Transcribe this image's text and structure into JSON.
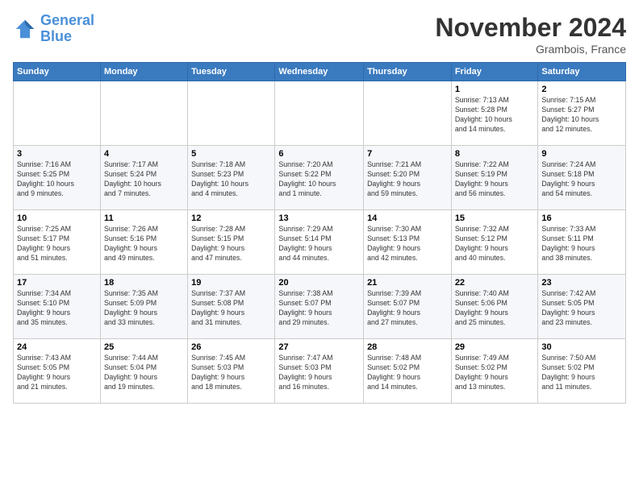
{
  "logo": {
    "line1": "General",
    "line2": "Blue"
  },
  "title": "November 2024",
  "location": "Grambois, France",
  "days_header": [
    "Sunday",
    "Monday",
    "Tuesday",
    "Wednesday",
    "Thursday",
    "Friday",
    "Saturday"
  ],
  "weeks": [
    [
      {
        "day": "",
        "info": ""
      },
      {
        "day": "",
        "info": ""
      },
      {
        "day": "",
        "info": ""
      },
      {
        "day": "",
        "info": ""
      },
      {
        "day": "",
        "info": ""
      },
      {
        "day": "1",
        "info": "Sunrise: 7:13 AM\nSunset: 5:28 PM\nDaylight: 10 hours\nand 14 minutes."
      },
      {
        "day": "2",
        "info": "Sunrise: 7:15 AM\nSunset: 5:27 PM\nDaylight: 10 hours\nand 12 minutes."
      }
    ],
    [
      {
        "day": "3",
        "info": "Sunrise: 7:16 AM\nSunset: 5:25 PM\nDaylight: 10 hours\nand 9 minutes."
      },
      {
        "day": "4",
        "info": "Sunrise: 7:17 AM\nSunset: 5:24 PM\nDaylight: 10 hours\nand 7 minutes."
      },
      {
        "day": "5",
        "info": "Sunrise: 7:18 AM\nSunset: 5:23 PM\nDaylight: 10 hours\nand 4 minutes."
      },
      {
        "day": "6",
        "info": "Sunrise: 7:20 AM\nSunset: 5:22 PM\nDaylight: 10 hours\nand 1 minute."
      },
      {
        "day": "7",
        "info": "Sunrise: 7:21 AM\nSunset: 5:20 PM\nDaylight: 9 hours\nand 59 minutes."
      },
      {
        "day": "8",
        "info": "Sunrise: 7:22 AM\nSunset: 5:19 PM\nDaylight: 9 hours\nand 56 minutes."
      },
      {
        "day": "9",
        "info": "Sunrise: 7:24 AM\nSunset: 5:18 PM\nDaylight: 9 hours\nand 54 minutes."
      }
    ],
    [
      {
        "day": "10",
        "info": "Sunrise: 7:25 AM\nSunset: 5:17 PM\nDaylight: 9 hours\nand 51 minutes."
      },
      {
        "day": "11",
        "info": "Sunrise: 7:26 AM\nSunset: 5:16 PM\nDaylight: 9 hours\nand 49 minutes."
      },
      {
        "day": "12",
        "info": "Sunrise: 7:28 AM\nSunset: 5:15 PM\nDaylight: 9 hours\nand 47 minutes."
      },
      {
        "day": "13",
        "info": "Sunrise: 7:29 AM\nSunset: 5:14 PM\nDaylight: 9 hours\nand 44 minutes."
      },
      {
        "day": "14",
        "info": "Sunrise: 7:30 AM\nSunset: 5:13 PM\nDaylight: 9 hours\nand 42 minutes."
      },
      {
        "day": "15",
        "info": "Sunrise: 7:32 AM\nSunset: 5:12 PM\nDaylight: 9 hours\nand 40 minutes."
      },
      {
        "day": "16",
        "info": "Sunrise: 7:33 AM\nSunset: 5:11 PM\nDaylight: 9 hours\nand 38 minutes."
      }
    ],
    [
      {
        "day": "17",
        "info": "Sunrise: 7:34 AM\nSunset: 5:10 PM\nDaylight: 9 hours\nand 35 minutes."
      },
      {
        "day": "18",
        "info": "Sunrise: 7:35 AM\nSunset: 5:09 PM\nDaylight: 9 hours\nand 33 minutes."
      },
      {
        "day": "19",
        "info": "Sunrise: 7:37 AM\nSunset: 5:08 PM\nDaylight: 9 hours\nand 31 minutes."
      },
      {
        "day": "20",
        "info": "Sunrise: 7:38 AM\nSunset: 5:07 PM\nDaylight: 9 hours\nand 29 minutes."
      },
      {
        "day": "21",
        "info": "Sunrise: 7:39 AM\nSunset: 5:07 PM\nDaylight: 9 hours\nand 27 minutes."
      },
      {
        "day": "22",
        "info": "Sunrise: 7:40 AM\nSunset: 5:06 PM\nDaylight: 9 hours\nand 25 minutes."
      },
      {
        "day": "23",
        "info": "Sunrise: 7:42 AM\nSunset: 5:05 PM\nDaylight: 9 hours\nand 23 minutes."
      }
    ],
    [
      {
        "day": "24",
        "info": "Sunrise: 7:43 AM\nSunset: 5:05 PM\nDaylight: 9 hours\nand 21 minutes."
      },
      {
        "day": "25",
        "info": "Sunrise: 7:44 AM\nSunset: 5:04 PM\nDaylight: 9 hours\nand 19 minutes."
      },
      {
        "day": "26",
        "info": "Sunrise: 7:45 AM\nSunset: 5:03 PM\nDaylight: 9 hours\nand 18 minutes."
      },
      {
        "day": "27",
        "info": "Sunrise: 7:47 AM\nSunset: 5:03 PM\nDaylight: 9 hours\nand 16 minutes."
      },
      {
        "day": "28",
        "info": "Sunrise: 7:48 AM\nSunset: 5:02 PM\nDaylight: 9 hours\nand 14 minutes."
      },
      {
        "day": "29",
        "info": "Sunrise: 7:49 AM\nSunset: 5:02 PM\nDaylight: 9 hours\nand 13 minutes."
      },
      {
        "day": "30",
        "info": "Sunrise: 7:50 AM\nSunset: 5:02 PM\nDaylight: 9 hours\nand 11 minutes."
      }
    ]
  ]
}
